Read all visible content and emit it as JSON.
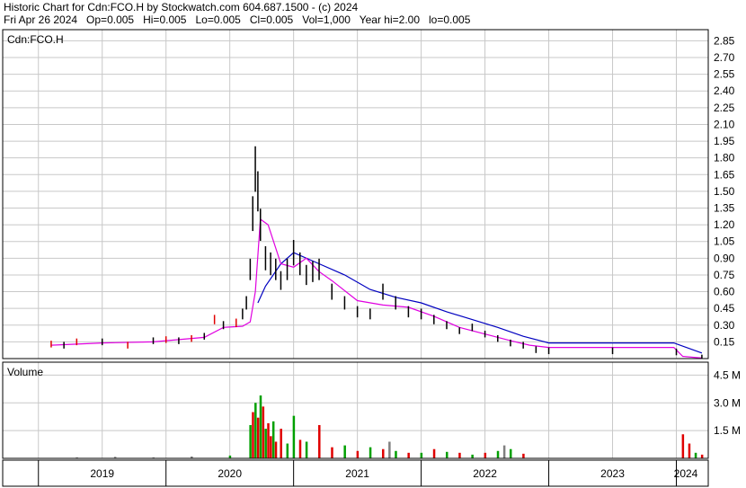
{
  "header": {
    "line1": "Historic Chart for Cdn:FCO.H by Stockwatch.com 604.687.1500 - (c) 2024",
    "line2": "Fri Apr 26 2024   Op=0.005   Hi=0.005   Lo=0.005   Cl=0.005   Vol=1,000   Year hi=2.00   lo=0.005"
  },
  "colors": {
    "price_bar": "#000000",
    "ma_short": "#e000e0",
    "ma_long": "#0000c0",
    "vol_up": "#00a000",
    "vol_down": "#e00000",
    "vol_flat": "#808080",
    "grid": "#c8c8c8"
  },
  "chart_data": [
    {
      "type": "line",
      "title": "Cdn:FCO.H",
      "ylim": [
        0,
        2.95
      ],
      "y_ticks": [
        "2.85",
        "2.70",
        "2.55",
        "2.40",
        "2.25",
        "2.10",
        "1.95",
        "1.80",
        "1.65",
        "1.50",
        "1.35",
        "1.20",
        "1.05",
        "0.90",
        "0.75",
        "0.60",
        "0.45",
        "0.30",
        "0.15"
      ],
      "x_ticks": [
        "2019",
        "2020",
        "2021",
        "2022",
        "2023",
        "2024"
      ],
      "grid": true,
      "series": [
        {
          "name": "",
          "role": "price",
          "x": [
            2019.1,
            2019.2,
            2019.3,
            2019.5,
            2019.7,
            2019.9,
            2020.0,
            2020.1,
            2020.2,
            2020.3,
            2020.38,
            2020.45,
            2020.55,
            2020.6,
            2020.63,
            2020.66,
            2020.68,
            2020.7,
            2020.72,
            2020.74,
            2020.78,
            2020.82,
            2020.86,
            2020.9,
            2020.95,
            2021.0,
            2021.05,
            2021.1,
            2021.15,
            2021.2,
            2021.3,
            2021.4,
            2021.5,
            2021.6,
            2021.7,
            2021.8,
            2021.9,
            2022.0,
            2022.1,
            2022.2,
            2022.3,
            2022.4,
            2022.5,
            2022.6,
            2022.7,
            2022.8,
            2022.9,
            2023.0,
            2023.5,
            2024.0,
            2024.2
          ],
          "y": [
            0.13,
            0.12,
            0.15,
            0.15,
            0.12,
            0.16,
            0.17,
            0.16,
            0.18,
            0.2,
            0.35,
            0.3,
            0.32,
            0.4,
            0.5,
            0.8,
            1.3,
            1.7,
            1.5,
            1.2,
            0.9,
            0.85,
            0.8,
            0.7,
            0.8,
            0.95,
            0.85,
            0.75,
            0.78,
            0.8,
            0.6,
            0.5,
            0.42,
            0.4,
            0.6,
            0.5,
            0.42,
            0.4,
            0.35,
            0.3,
            0.25,
            0.28,
            0.22,
            0.18,
            0.14,
            0.12,
            0.08,
            0.07,
            0.07,
            0.06,
            0.005
          ]
        },
        {
          "name": "",
          "role": "ma_short",
          "x": [
            2019.1,
            2019.5,
            2019.9,
            2020.1,
            2020.3,
            2020.45,
            2020.6,
            2020.66,
            2020.7,
            2020.74,
            2020.8,
            2020.9,
            2021.0,
            2021.1,
            2021.2,
            2021.3,
            2021.5,
            2021.7,
            2021.9,
            2022.1,
            2022.3,
            2022.5,
            2022.7,
            2022.85,
            2023.0,
            2023.5,
            2023.98,
            2024.05,
            2024.2
          ],
          "y": [
            0.12,
            0.14,
            0.15,
            0.17,
            0.19,
            0.28,
            0.29,
            0.33,
            0.6,
            1.25,
            1.2,
            0.85,
            0.82,
            0.9,
            0.78,
            0.7,
            0.52,
            0.48,
            0.46,
            0.38,
            0.28,
            0.22,
            0.16,
            0.12,
            0.1,
            0.1,
            0.1,
            0.02,
            0.005
          ]
        },
        {
          "name": "",
          "role": "ma_long",
          "x": [
            2020.72,
            2020.78,
            2020.9,
            2021.0,
            2021.2,
            2021.4,
            2021.6,
            2021.8,
            2022.0,
            2022.2,
            2022.4,
            2022.6,
            2022.8,
            2023.0,
            2023.5,
            2023.98,
            2024.2
          ],
          "y": [
            0.5,
            0.65,
            0.85,
            0.95,
            0.85,
            0.75,
            0.62,
            0.55,
            0.5,
            0.42,
            0.35,
            0.28,
            0.2,
            0.14,
            0.14,
            0.14,
            0.05
          ]
        }
      ]
    },
    {
      "type": "bar",
      "title": "Volume",
      "ylim": [
        0,
        5.2
      ],
      "y_ticks": [
        "4.5 M",
        "3.0 M",
        "1.5 M"
      ],
      "values_unit": "M",
      "x": [
        2019.3,
        2019.6,
        2019.9,
        2020.2,
        2020.5,
        2020.66,
        2020.68,
        2020.7,
        2020.72,
        2020.74,
        2020.76,
        2020.78,
        2020.8,
        2020.82,
        2020.84,
        2020.86,
        2020.9,
        2020.95,
        2021.0,
        2021.05,
        2021.1,
        2021.2,
        2021.3,
        2021.4,
        2021.5,
        2021.6,
        2021.7,
        2021.75,
        2021.8,
        2021.9,
        2022.0,
        2022.1,
        2022.2,
        2022.3,
        2022.4,
        2022.5,
        2022.6,
        2022.65,
        2022.7,
        2022.8,
        2023.0,
        2023.5,
        2024.05,
        2024.1,
        2024.15,
        2024.2
      ],
      "values": [
        0.05,
        0.08,
        0.05,
        0.1,
        0.15,
        1.8,
        2.5,
        3.0,
        2.2,
        3.4,
        2.8,
        1.6,
        1.9,
        1.2,
        2.0,
        0.9,
        1.6,
        0.8,
        2.3,
        1.0,
        0.9,
        1.8,
        0.6,
        0.7,
        0.4,
        0.6,
        0.5,
        0.9,
        0.4,
        0.3,
        0.3,
        0.5,
        0.35,
        0.3,
        0.2,
        0.3,
        0.4,
        0.7,
        0.5,
        0.25,
        0.02,
        0.02,
        1.3,
        0.8,
        0.3,
        0.2
      ],
      "dir": [
        "f",
        "f",
        "f",
        "f",
        "u",
        "u",
        "d",
        "u",
        "d",
        "u",
        "d",
        "u",
        "d",
        "d",
        "u",
        "d",
        "d",
        "u",
        "u",
        "d",
        "u",
        "d",
        "d",
        "u",
        "d",
        "u",
        "d",
        "f",
        "u",
        "d",
        "u",
        "d",
        "u",
        "d",
        "u",
        "d",
        "u",
        "f",
        "u",
        "d",
        "f",
        "f",
        "d",
        "d",
        "u",
        "d"
      ]
    }
  ]
}
